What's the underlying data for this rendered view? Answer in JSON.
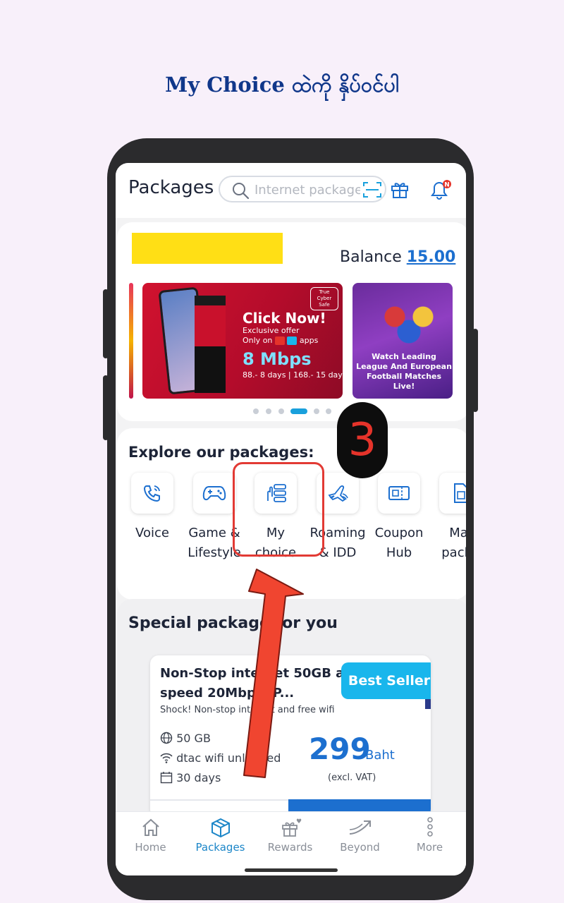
{
  "instruction": "My Choice ထဲကို နှိပ်ဝင်ပါ",
  "step_number": "3",
  "header": {
    "title": "Packages",
    "search_placeholder": "Internet package"
  },
  "balance": {
    "label": "Balance",
    "amount": "15.00"
  },
  "banners": {
    "main": {
      "headline": "Click Now!",
      "sub1": "Exclusive offer",
      "sub2": "Only on",
      "sub2_suffix": "apps",
      "speed": "8 Mbps",
      "price_line": "88.- 8 days | 168.- 15 days",
      "badge": "True Cyber Safe"
    },
    "right": {
      "text": "Watch Leading League And European Football Matches Live!"
    }
  },
  "explore": {
    "title": "Explore our packages:",
    "categories": [
      {
        "line1": "Voice",
        "line2": ""
      },
      {
        "line1": "Game &",
        "line2": "Lifestyle"
      },
      {
        "line1": "My",
        "line2": "choice"
      },
      {
        "line1": "Roaming",
        "line2": "& IDD"
      },
      {
        "line1": "Coupon",
        "line2": "Hub"
      },
      {
        "line1": "Mai",
        "line2": "packa"
      }
    ]
  },
  "special": {
    "title": "Special package for you",
    "card": {
      "name_line1": "Non-Stop internet 50GB at",
      "name_line2": "speed 20Mbps, P...",
      "desc": "Shock! Non-stop internet and free wifi",
      "badge": "Best Seller",
      "features": [
        "50 GB",
        "dtac wifi unlimited",
        "30 days"
      ],
      "price": "299",
      "currency": "Baht",
      "vat_note": "(excl. VAT)"
    }
  },
  "nav": {
    "items": [
      {
        "label": "Home",
        "active": false
      },
      {
        "label": "Packages",
        "active": true
      },
      {
        "label": "Rewards",
        "active": false
      },
      {
        "label": "Beyond",
        "active": false
      },
      {
        "label": "More",
        "active": false
      }
    ]
  },
  "colors": {
    "brand_blue": "#1c6fcf",
    "accent_cyan": "#19b6ec",
    "highlight_red": "#e23a34",
    "yellow_block": "#ffdf15",
    "headline_navy": "#10378a"
  }
}
